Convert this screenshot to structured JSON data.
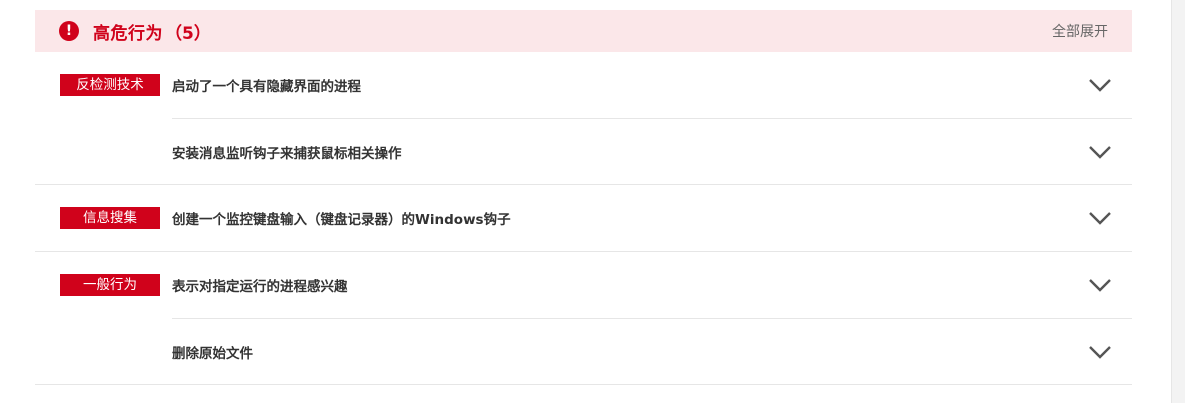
{
  "header": {
    "icon": "exclamation-icon",
    "title": "高危行为",
    "count": "（5）",
    "expand_all": "全部展开"
  },
  "groups": [
    {
      "tag": "反检测技术",
      "items": [
        "启动了一个具有隐藏界面的进程",
        "安装消息监听钩子来捕获鼠标相关操作"
      ]
    },
    {
      "tag": "信息搜集",
      "items": [
        "创建一个监控键盘输入（键盘记录器）的Windows钩子"
      ]
    },
    {
      "tag": "一般行为",
      "items": [
        "表示对指定运行的进程感兴趣",
        "删除原始文件"
      ]
    }
  ],
  "colors": {
    "accent": "#d0021b",
    "header_bg": "#fbe7e9"
  }
}
